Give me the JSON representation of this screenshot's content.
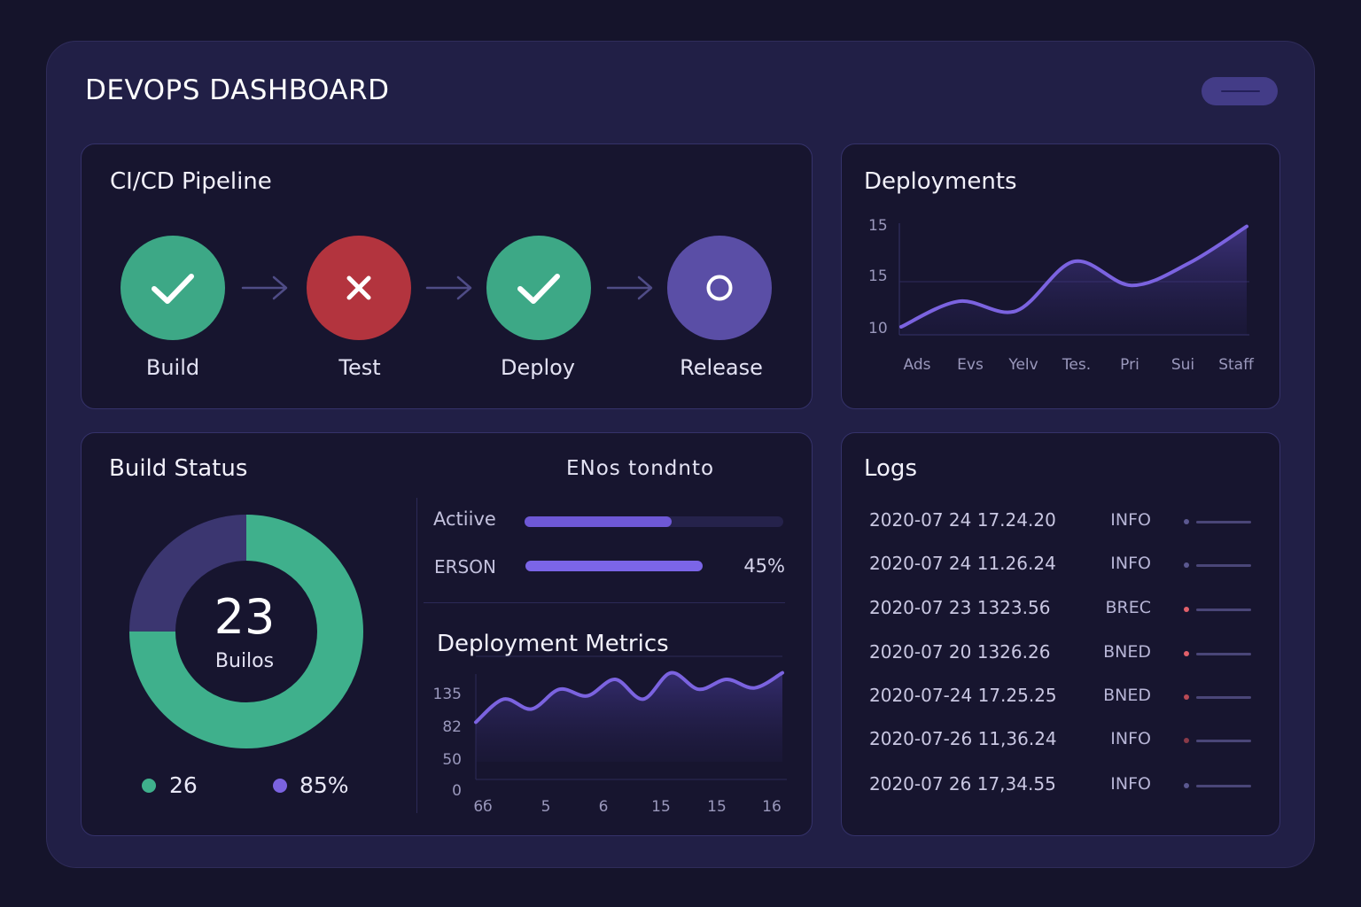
{
  "header": {
    "title": "DEVOPS DASHBOARD"
  },
  "pipeline": {
    "title": "CI/CD Pipeline",
    "stages": [
      {
        "label": "Build",
        "status": "success",
        "icon": "check-icon",
        "color": "#3da886"
      },
      {
        "label": "Test",
        "status": "failed",
        "icon": "x-icon",
        "color": "#b3343e"
      },
      {
        "label": "Deploy",
        "status": "success",
        "icon": "check-icon",
        "color": "#3da886"
      },
      {
        "label": "Release",
        "status": "pending",
        "icon": "circle-icon",
        "color": "#5a4ea6"
      }
    ]
  },
  "deployments": {
    "title": "Deployments",
    "chart_data": {
      "type": "area",
      "categories": [
        "Ads",
        "Evs",
        "Yelv",
        "Tes.",
        "Pri",
        "Sui",
        "Staff"
      ],
      "y_ticks": [
        "15",
        "15",
        "10"
      ],
      "series": [
        {
          "values": [
            10.0,
            11.6,
            11.0,
            14.1,
            12.6,
            14.0,
            16.3
          ]
        }
      ],
      "ylim": [
        9.5,
        16.5
      ],
      "color": "#7b63e0",
      "grid": true
    }
  },
  "build_status": {
    "title": "Build Status",
    "donut_value": "23",
    "donut_label": "Builos",
    "chart_data": {
      "type": "pie",
      "slices": [
        {
          "value": 75,
          "color": "#3fb08c"
        },
        {
          "value": 25,
          "color": "#3b3670"
        }
      ]
    },
    "legend": [
      {
        "text": "26",
        "color": "#3fb08c"
      },
      {
        "text": "85%",
        "color": "#7b63e0"
      }
    ]
  },
  "progress": {
    "header": "ENos tondnto",
    "items": [
      {
        "label": "Actiive",
        "value_text": "",
        "fraction": 0.57
      },
      {
        "label": "ERSON",
        "value_text": "45%",
        "fraction": 0.69
      }
    ],
    "fill_color": "#6e58d6"
  },
  "deployment_metrics": {
    "title": "Deployment Metrics",
    "chart_data": {
      "type": "area",
      "x_ticks": [
        "6б",
        "5",
        "6",
        "15",
        "15",
        "16"
      ],
      "y_ticks": [
        "135",
        "82",
        "50",
        "0"
      ],
      "series": [
        {
          "values": [
            60,
            95,
            80,
            110,
            100,
            125,
            95,
            135,
            110,
            125,
            112,
            135
          ]
        }
      ],
      "ylim": [
        0,
        160
      ],
      "color": "#7b63e0"
    }
  },
  "logs": {
    "title": "Logs",
    "rows": [
      {
        "time": "2020-07 24 17.24.20",
        "level": "INFO",
        "dot": "#5b5890"
      },
      {
        "time": "2020-07 24 11.26.24",
        "level": "INFO",
        "dot": "#5b5890"
      },
      {
        "time": "2020-07 23 1323.56",
        "level": "BREC",
        "dot": "#e2606a"
      },
      {
        "time": "2020-07 20 1326.26",
        "level": "BNED",
        "dot": "#e2606a"
      },
      {
        "time": "2020-07-24 17.25.25",
        "level": "BNED",
        "dot": "#b94a55"
      },
      {
        "time": "2020-07-26 11,36.24",
        "level": "INFO",
        "dot": "#8a3a48"
      },
      {
        "time": "2020-07 26 17,34.55",
        "level": "INFO",
        "dot": "#5b5890"
      }
    ]
  }
}
